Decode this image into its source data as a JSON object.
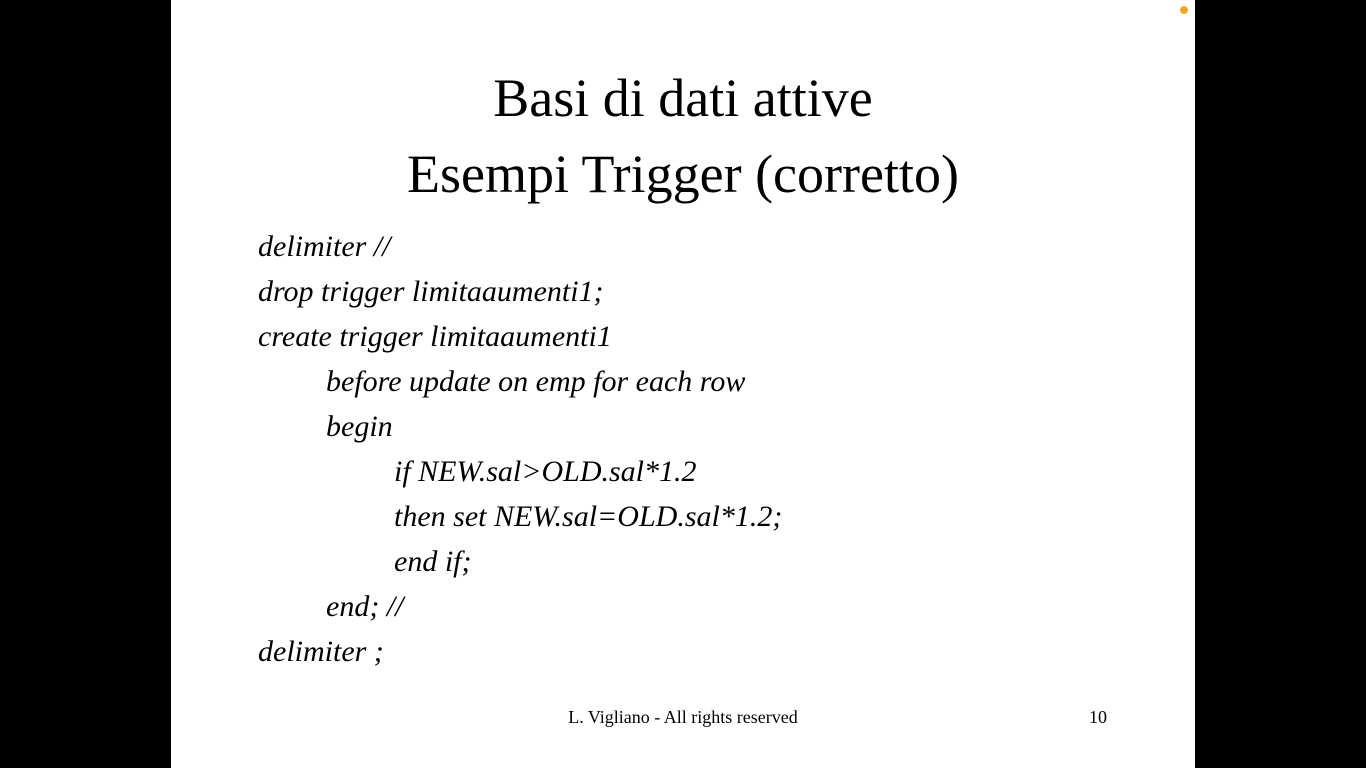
{
  "slide": {
    "title_line1": "Basi di dati attive",
    "title_line2": "Esempi Trigger (corretto)",
    "code_lines": [
      {
        "text": "delimiter //",
        "indent": 0
      },
      {
        "text": "drop trigger limitaaumenti1;",
        "indent": 0
      },
      {
        "text": "create trigger limitaaumenti1",
        "indent": 0
      },
      {
        "text": "before update on emp for each row",
        "indent": 1
      },
      {
        "text": "begin",
        "indent": 1
      },
      {
        "text": "if NEW.sal>OLD.sal*1.2",
        "indent": 2
      },
      {
        "text": "then set NEW.sal=OLD.sal*1.2;",
        "indent": 2
      },
      {
        "text": "end if;",
        "indent": 2
      },
      {
        "text": "end; //",
        "indent": 1
      },
      {
        "text": "delimiter ;",
        "indent": 0
      }
    ],
    "footer_credit": "L. Vigliano - All rights reserved",
    "page_number": "10"
  },
  "colors": {
    "slide_background": "#ffffff",
    "screen_background": "#000000",
    "pointer_dot": "#f5a623"
  },
  "icons": {
    "pointer": "laser-pointer-dot-icon"
  }
}
